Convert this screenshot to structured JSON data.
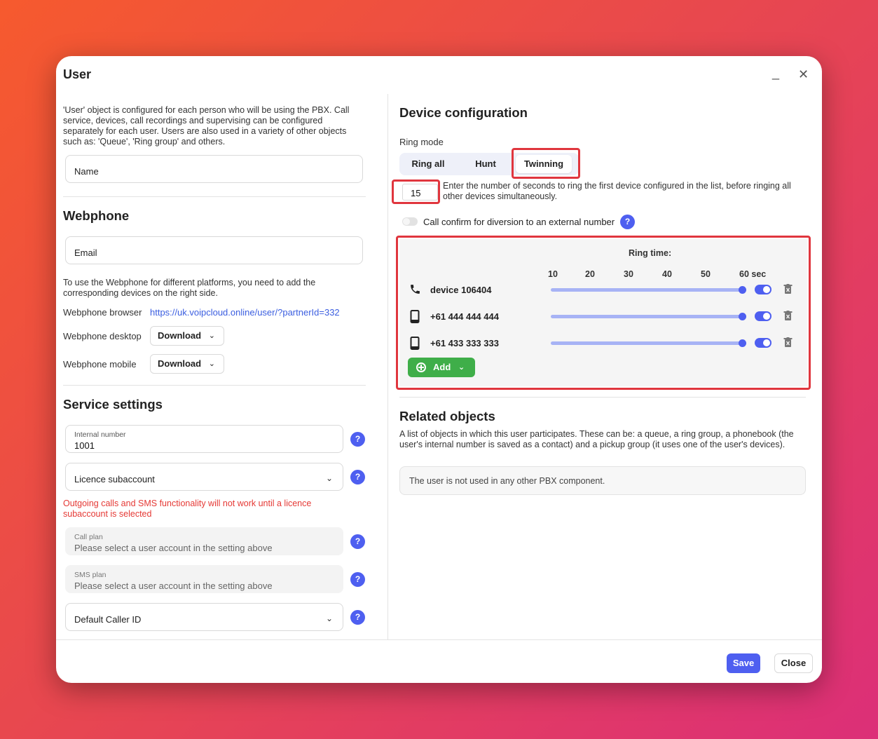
{
  "modal": {
    "title": "User"
  },
  "left": {
    "description": "'User' object is configured for each person who will be using the PBX. Call service, devices, call recordings and supervising can be configured separately for each user. Users are also used in a variety of other objects such as: 'Queue', 'Ring group' and others.",
    "name_label": "Name",
    "webphone": {
      "title": "Webphone",
      "email_label": "Email",
      "description": "To use the Webphone for different platforms, you need to add the corresponding devices on the right side.",
      "browser_label": "Webphone browser",
      "browser_link": "https://uk.voipcloud.online/user/?partnerId=332",
      "desktop_label": "Webphone desktop",
      "desktop_button": "Download",
      "mobile_label": "Webphone mobile",
      "mobile_button": "Download"
    },
    "service": {
      "title": "Service settings",
      "internal_number_label": "Internal number",
      "internal_number_value": "1001",
      "licence_label": "Licence subaccount",
      "warning": "Outgoing calls and SMS functionality will not work until a licence subaccount is selected",
      "call_plan_label": "Call plan",
      "call_plan_value": "Please select a user account in the setting above",
      "sms_plan_label": "SMS plan",
      "sms_plan_value": "Please select a user account in the setting above",
      "caller_id_label": "Default Caller ID",
      "help": "?"
    }
  },
  "right": {
    "device_config": {
      "title": "Device configuration",
      "ring_mode_label": "Ring mode",
      "ring_modes": [
        "Ring all",
        "Hunt",
        "Twinning"
      ],
      "active_mode": "Twinning",
      "seconds_value": "15",
      "seconds_description": "Enter the number of seconds to ring the first device configured in the list, before ringing all other devices simultaneously.",
      "call_confirm_label": "Call confirm for diversion to an external number",
      "call_confirm_enabled": false,
      "help": "?",
      "ring_time_label": "Ring time:",
      "ticks": [
        "10",
        "20",
        "30",
        "40",
        "50",
        "60 sec"
      ],
      "devices": [
        {
          "icon": "phone-icon",
          "label": "device 106404",
          "ring_time": 60,
          "enabled": true
        },
        {
          "icon": "mobile-icon",
          "label": "+61 444 444 444",
          "ring_time": 60,
          "enabled": true
        },
        {
          "icon": "mobile-icon",
          "label": "+61 433 333 333",
          "ring_time": 60,
          "enabled": true
        }
      ],
      "add_button": "Add"
    },
    "related": {
      "title": "Related objects",
      "description": "A list of objects in which this user participates. These can be: a queue, a ring group, a phonebook (the user's internal number is saved as a contact) and a pickup group (it uses one of the user's devices).",
      "info": "The user is not used in any other PBX component."
    }
  },
  "footer": {
    "save": "Save",
    "close": "Close"
  },
  "colors": {
    "accent": "#4e5ff0",
    "add_green": "#3fae49",
    "warning_red": "#e53935",
    "highlight_red": "#e0363e"
  },
  "window_controls": {
    "minimize": "_",
    "close": "✕"
  }
}
